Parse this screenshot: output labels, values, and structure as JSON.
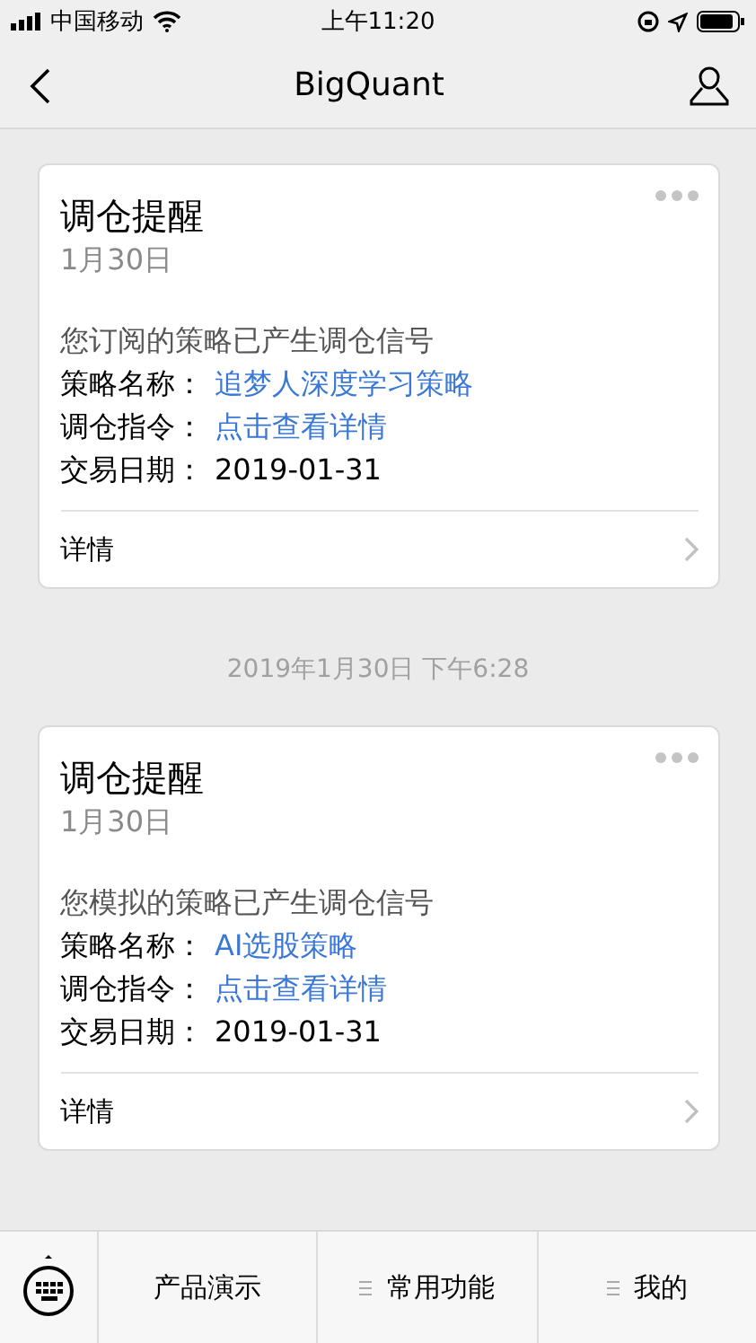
{
  "status_bar": {
    "carrier": "中国移动",
    "time": "上午11:20"
  },
  "nav": {
    "title": "BigQuant"
  },
  "messages": [
    {
      "title": "调仓提醒",
      "date": "1月30日",
      "intro": "您订阅的策略已产生调仓信号",
      "fields": [
        {
          "label": "策略名称：",
          "value": "追梦人深度学习策略",
          "kind": "link"
        },
        {
          "label": "调仓指令：",
          "value": "点击查看详情",
          "kind": "link"
        },
        {
          "label": "交易日期：",
          "value": "2019-01-31",
          "kind": "text"
        }
      ],
      "footer": "详情",
      "timestamp": "2019年1月30日 下午6:28"
    },
    {
      "title": "调仓提醒",
      "date": "1月30日",
      "intro": "您模拟的策略已产生调仓信号",
      "fields": [
        {
          "label": "策略名称：",
          "value": "AI选股策略",
          "kind": "link"
        },
        {
          "label": "调仓指令：",
          "value": "点击查看详情",
          "kind": "link"
        },
        {
          "label": "交易日期：",
          "value": "2019-01-31",
          "kind": "text"
        }
      ],
      "footer": "详情"
    }
  ],
  "menu": [
    {
      "label": "产品演示",
      "submenu": false
    },
    {
      "label": "常用功能",
      "submenu": true
    },
    {
      "label": "我的",
      "submenu": true
    }
  ]
}
